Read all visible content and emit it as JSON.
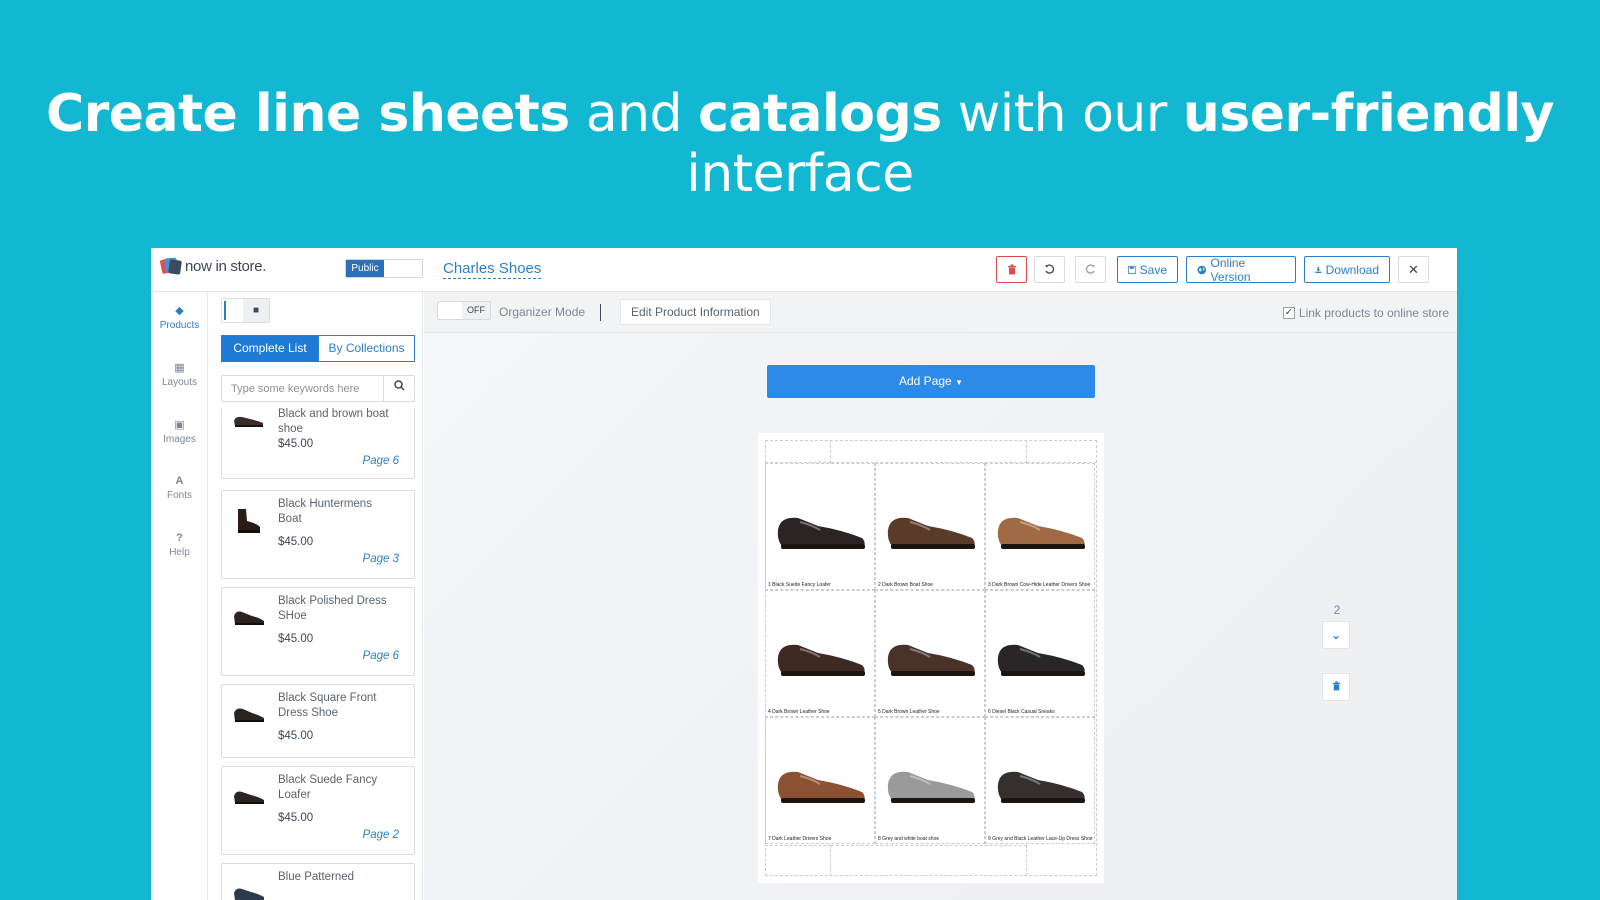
{
  "headline": {
    "part1": "Create line sheets",
    "part2": " and ",
    "part3": "catalogs",
    "part4": " with our ",
    "part5": "user-friendly",
    "part6": " interface"
  },
  "topbar": {
    "logo_text": "now in store.",
    "public_label": "Public",
    "doc_title": "Charles Shoes",
    "save_label": "Save",
    "online_label": "Online Version",
    "download_label": "Download"
  },
  "rail": {
    "products": "Products",
    "layouts": "Layouts",
    "images": "Images",
    "fonts": "Fonts",
    "help": "Help"
  },
  "panel": {
    "tab_complete": "Complete List",
    "tab_collections": "By Collections",
    "search_placeholder": "Type some keywords here",
    "products": [
      {
        "name": "Black and brown boat shoe",
        "price": "$45.00",
        "page": "Page 6"
      },
      {
        "name": "Black Huntermens Boat",
        "price": "$45.00",
        "page": "Page 3"
      },
      {
        "name": "Black Polished Dress SHoe",
        "price": "$45.00",
        "page": "Page 6"
      },
      {
        "name": "Black Square Front Dress Shoe",
        "price": "$45.00",
        "page": ""
      },
      {
        "name": "Black Suede Fancy Loafer",
        "price": "$45.00",
        "page": "Page 2"
      },
      {
        "name": "Blue Patterned",
        "price": "",
        "page": ""
      }
    ]
  },
  "subbar": {
    "toggle_state": "OFF",
    "organizer_label": "Organizer Mode",
    "edit_label": "Edit Product Information",
    "link_label": "Link products to online store"
  },
  "canvas": {
    "add_page_label": "Add Page",
    "page_number": "2",
    "cells": [
      {
        "caption": "1 Black Suede Fancy Loafer",
        "color": "#2b2423"
      },
      {
        "caption": "2 Dark Brown Boat Shoe",
        "color": "#5a3a28"
      },
      {
        "caption": "3 Dark Brown Cow-Hide Leather Drivers Shoe",
        "color": "#a06a45"
      },
      {
        "caption": "4 Dark Brown Leather Shoe",
        "color": "#3e2a22"
      },
      {
        "caption": "5 Dark Brown Leather Shoe",
        "color": "#4a3228"
      },
      {
        "caption": "6 Diesel Black Casual Sneaks",
        "color": "#2a2526"
      },
      {
        "caption": "7 Dark Leather Drivers Shoe",
        "color": "#8a5232"
      },
      {
        "caption": "8 Grey and white boat shoe",
        "color": "#9a9a9c"
      },
      {
        "caption": "9 Grey and Black Leather Lace-Up Dress Shoe",
        "color": "#35302e"
      }
    ]
  },
  "colors": {
    "background": "#12b8d2",
    "accent": "#2c7fc7",
    "primary_button": "#2d8ae8",
    "delete": "#e24a4a"
  }
}
